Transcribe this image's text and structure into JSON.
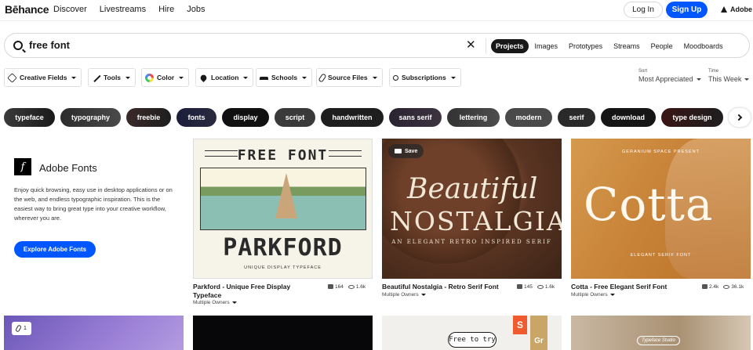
{
  "nav": {
    "logo": "Bēhance",
    "links": [
      "Discover",
      "Livestreams",
      "Hire",
      "Jobs"
    ],
    "login": "Log In",
    "signup": "Sign Up",
    "adobe": "Adobe"
  },
  "search": {
    "query": "free font",
    "tabs": [
      "Projects",
      "Images",
      "Prototypes",
      "Streams",
      "People",
      "Moodboards"
    ],
    "active_tab": "Projects"
  },
  "filters": [
    "Creative Fields",
    "Tools",
    "Color",
    "Location",
    "Schools",
    "Source Files",
    "Subscriptions"
  ],
  "sort": {
    "label": "Sort",
    "value": "Most Appreciated"
  },
  "time": {
    "label": "Time",
    "value": "This Week"
  },
  "tags": [
    "typeface",
    "typography",
    "freebie",
    "fonts",
    "display",
    "script",
    "handwritten",
    "sans serif",
    "lettering",
    "modern",
    "serif",
    "download",
    "type design"
  ],
  "promo": {
    "logo_glyph": "f",
    "title": "Adobe Fonts",
    "description": "Enjoy quick browsing, easy use in desktop applications or on the web, and endless typographic inspiration. This is the easiest way to bring great type into your creative workflow, wherever you are.",
    "button": "Explore Adobe Fonts"
  },
  "cards": [
    {
      "title": "Parkford - Unique Free Display Typeface",
      "owner": "Multiple Owners",
      "likes": "164",
      "views": "1.6k",
      "art": {
        "top": "FREE FONT",
        "name": "PARKFORD",
        "sub": "UNIQUE DISPLAY TYPEFACE"
      }
    },
    {
      "title": "Beautiful Nostalgia - Retro Serif Font",
      "owner": "Multiple Owners",
      "likes": "145",
      "views": "1.6k",
      "save": "Save",
      "art": {
        "line1": "Beautiful",
        "line2": "NOSTALGIA",
        "sub": "AN ELEGANT RETRO INSPIRED SERIF"
      }
    },
    {
      "title": "Cotta - Free Elegant Serif Font",
      "owner": "Multiple Owners",
      "likes": "2.4k",
      "views": "36.1k",
      "art": {
        "top": "GERANIUM SPACE PRESENT",
        "name": "Cotta",
        "sub": "ELEGANT SERIF FONT"
      }
    }
  ],
  "bottom": {
    "badge_count": "1",
    "try_label": "Free to try",
    "s_logo": "S",
    "gr_logo": "Gr",
    "typo_mark": "Typeface Studio"
  },
  "colors": {
    "accent": "#0057ff",
    "text": "#191919"
  }
}
